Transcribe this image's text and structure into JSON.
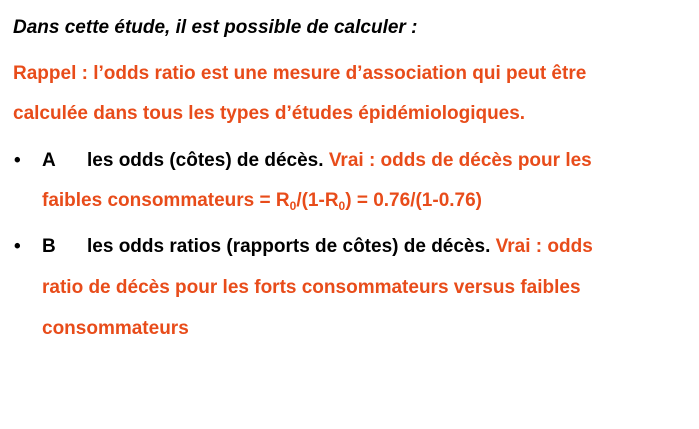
{
  "title": "Dans cette étude, il est possible de calculer :",
  "rappel": {
    "line1": "Rappel : l’odds ratio est une mesure d’association qui peut être",
    "line2": "calculée dans tous les types d’études épidémiologiques."
  },
  "items": [
    {
      "bullet": "•",
      "letter": "A",
      "text": "les odds (côtes) de décès.",
      "answer_line1": "Vrai : odds de décès pour les",
      "answer_line2": {
        "p1": "faibles consommateurs = R",
        "sub1": "0",
        "p2": "/(1-R",
        "sub2": "0",
        "p3": ") = 0.76/(1-0.76)"
      }
    },
    {
      "bullet": "•",
      "letter": "B",
      "text": "les odds ratios (rapports de côtes) de décès.",
      "answer_line1": "Vrai : odds",
      "answer_line2": "ratio de décès pour les forts consommateurs versus faibles",
      "answer_line3": "consommateurs"
    }
  ],
  "colors": {
    "answer": "#e84c1a",
    "text": "#000000"
  }
}
